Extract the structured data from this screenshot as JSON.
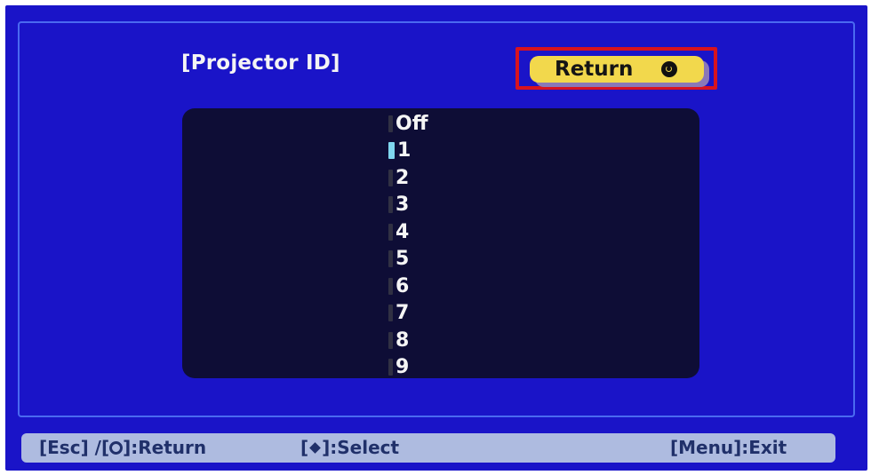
{
  "menu": {
    "title": "[Projector ID]",
    "return_label": "Return",
    "options": [
      "Off",
      "1",
      "2",
      "3",
      "4",
      "5",
      "6",
      "7",
      "8",
      "9"
    ],
    "selected_option": "1"
  },
  "footer": {
    "esc": "[Esc] /[",
    "return_suffix": "]:Return",
    "select_prefix": "[",
    "select_suffix": "]:Select",
    "exit": "[Menu]:Exit"
  },
  "colors": {
    "background": "#1a14c8",
    "list_background": "#0e0d36",
    "return_button": "#f2d84c",
    "highlight_border": "#d8131f",
    "footer_bar": "#aebbe0",
    "selected_radio": "#7fd6ee"
  },
  "icons": {
    "return": "enter-circle-icon",
    "select": "diamond-arrow-icon"
  }
}
